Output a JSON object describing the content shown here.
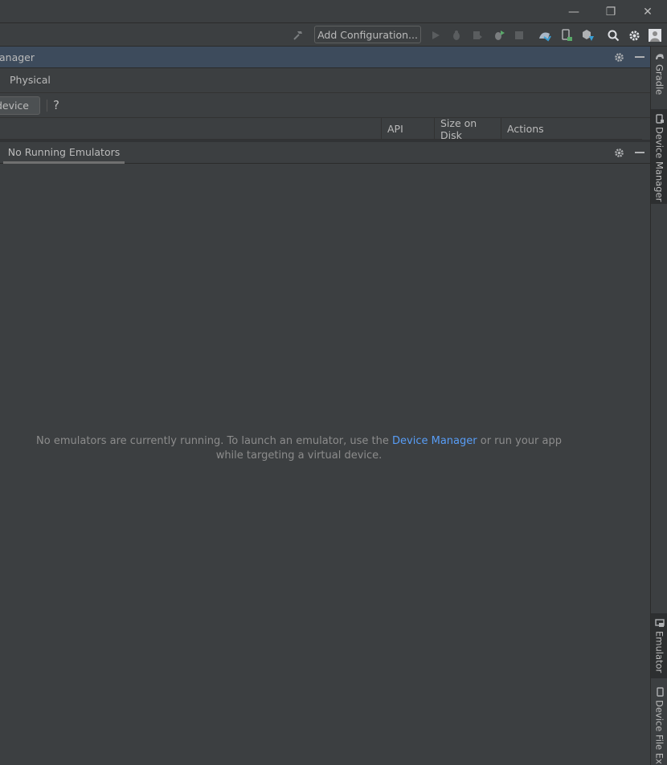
{
  "window": {
    "minimize_glyph": "—",
    "maximize_glyph": "❐",
    "close_glyph": "✕"
  },
  "toolbar": {
    "add_configuration_label": "Add Configuration...",
    "icons": [
      "hammer-icon",
      "run-icon",
      "debug-icon",
      "profile-icon",
      "apply-changes-icon",
      "stop-icon",
      "sync-gradle-icon",
      "device-manager-icon",
      "sdk-manager-icon",
      "search-icon",
      "settings-icon",
      "avatar-icon"
    ]
  },
  "device_manager": {
    "title": "anager",
    "tabs": [
      {
        "label": "Physical"
      }
    ],
    "pair_button_label": "device",
    "help_label": "?",
    "columns": [
      {
        "label": "API"
      },
      {
        "label": "Size on Disk"
      },
      {
        "label": "Actions"
      }
    ]
  },
  "emulator_panel": {
    "tab_label": "No Running Emulators",
    "empty_text_before": "No emulators are currently running. To launch an emulator, use the ",
    "empty_link": "Device Manager",
    "empty_text_after": " or run your app",
    "empty_text_line2": "while targeting a virtual device."
  },
  "right_sidebar": {
    "tabs": [
      {
        "label": "Gradle",
        "active": false
      },
      {
        "label": "Device Manager",
        "active": true
      },
      {
        "label": "Emulator",
        "active": true
      },
      {
        "label": "Device File Exp",
        "active": false
      }
    ]
  },
  "colors": {
    "background": "#3c3f41",
    "header_active": "#3d4b5c",
    "link": "#589df6",
    "run_green": "#59a869"
  }
}
